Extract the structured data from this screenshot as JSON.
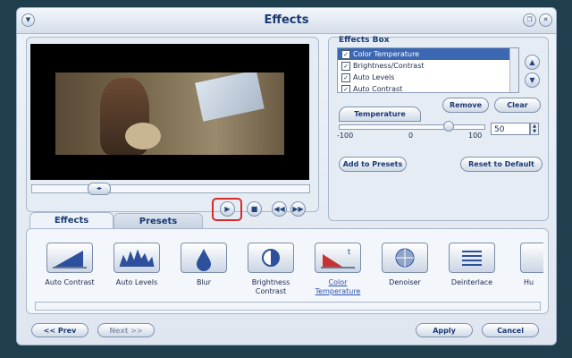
{
  "window": {
    "title": "Effects"
  },
  "effects_box": {
    "label": "Effects Box",
    "items": [
      {
        "label": "Color Temperature",
        "checked": true,
        "selected": true
      },
      {
        "label": "Brightness/Contrast",
        "checked": true,
        "selected": false
      },
      {
        "label": "Auto Levels",
        "checked": true,
        "selected": false
      },
      {
        "label": "Auto Contrast",
        "checked": true,
        "selected": false
      }
    ],
    "remove_label": "Remove",
    "clear_label": "Clear"
  },
  "temperature": {
    "tab_label": "Temperature",
    "min_label": "-100",
    "mid_label": "0",
    "max_label": "100",
    "value": "50",
    "slider_fraction": 0.75
  },
  "actions": {
    "add_presets_label": "Add to Presets",
    "reset_label": "Reset to Default"
  },
  "tabs": {
    "effects": "Effects",
    "presets": "Presets"
  },
  "effect_list": [
    "Auto Contrast",
    "Auto Levels",
    "Blur",
    "Brightness Contrast",
    "Color Temperature",
    "Denoiser",
    "Deinterlace",
    "Hu"
  ],
  "footer": {
    "prev_label": "<< Prev",
    "next_label": "Next >>",
    "apply_label": "Apply",
    "cancel_label": "Cancel"
  },
  "colors": {
    "accent": "#1a3a73",
    "selection": "#3b67b3",
    "highlight_ring": "#d62a2a"
  }
}
